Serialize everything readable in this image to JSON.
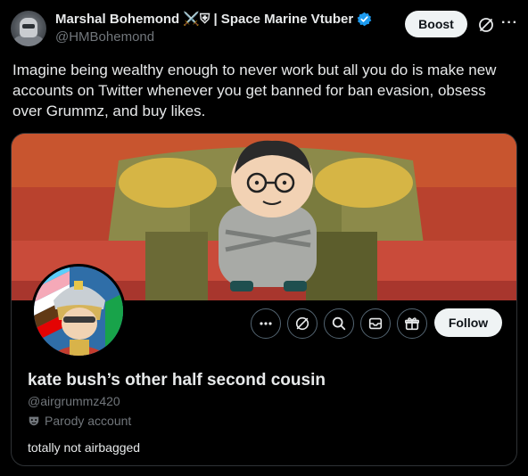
{
  "tweet": {
    "author_name": "Marshal Bohemond ⚔️⛨ | Space Marine Vtuber",
    "author_handle": "@HMBohemond",
    "boost_label": "Boost",
    "text": "Imagine being wealthy enough to never work but all you do is make new accounts on Twitter whenever you get banned for ban evasion, obsess over Grummz, and buy likes."
  },
  "profile_card": {
    "display_name": "kate bush’s other half second cousin",
    "handle": "@airgrummz420",
    "parody_label": "Parody account",
    "bio": "totally not airbagged",
    "follow_label": "Follow",
    "action_icons": [
      "more-icon",
      "grok-icon",
      "search-icon",
      "message-icon",
      "gift-icon"
    ]
  },
  "colors": {
    "background": "#000000",
    "text_primary": "#e7e9ea",
    "text_secondary": "#71767b",
    "verified_blue": "#1d9bf0",
    "button_bg": "#eff3f4"
  }
}
